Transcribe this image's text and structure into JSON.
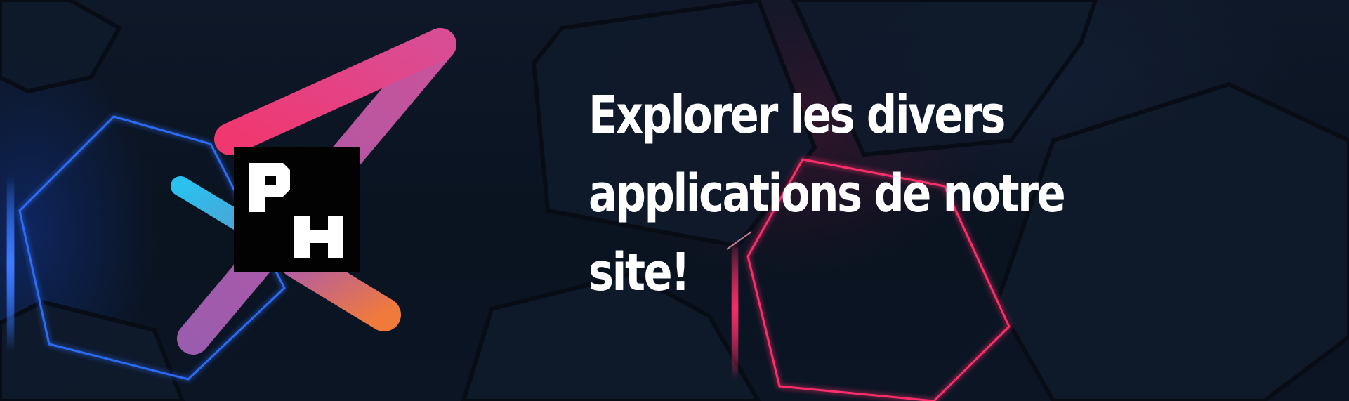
{
  "banner": {
    "headline": "Explorer les divers applications de notre site!"
  },
  "logo": {
    "icon": "ph-arrow-logo-icon",
    "monogram_letters": "PH"
  },
  "colors": {
    "background": "#0b1422",
    "text": "#ffffff",
    "hex_blue": "#2f6fff",
    "hex_pink": "#ff2d6a",
    "logo_pink": "#ec407a",
    "logo_cyan": "#29c1f0",
    "logo_orange": "#f07a3c",
    "logo_purple": "#9c5cae",
    "monogram_box": "#020202"
  }
}
